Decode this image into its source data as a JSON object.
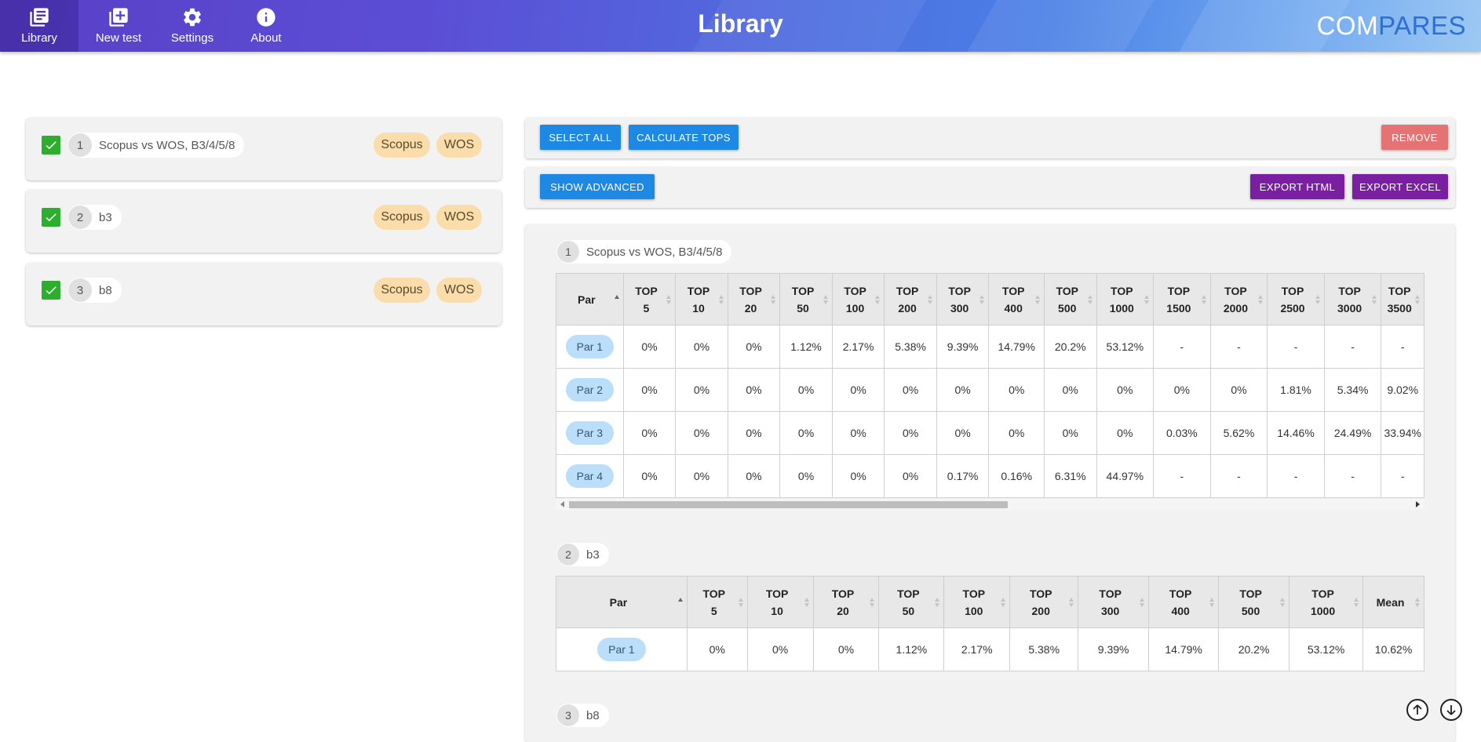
{
  "nav": [
    {
      "label": "Library",
      "icon": "library-icon"
    },
    {
      "label": "New test",
      "icon": "add-box-icon"
    },
    {
      "label": "Settings",
      "icon": "gear-icon"
    },
    {
      "label": "About",
      "icon": "info-icon"
    }
  ],
  "header": {
    "title": "Library",
    "brand_a": "COM",
    "brand_b": "PARES"
  },
  "colors": {
    "primary": "#1e88e5",
    "danger": "#e57373",
    "export": "#7b1fa2",
    "check": "#2eae2e",
    "db_chip": "#fbdcab",
    "par_chip": "#bbdefb"
  },
  "tests": [
    {
      "num": "1",
      "name": "Scopus vs WOS, B3/4/5/8",
      "db1": "Scopus",
      "db2": "WOS",
      "checked": true
    },
    {
      "num": "2",
      "name": "b3",
      "db1": "Scopus",
      "db2": "WOS",
      "checked": true
    },
    {
      "num": "3",
      "name": "b8",
      "db1": "Scopus",
      "db2": "WOS",
      "checked": true
    }
  ],
  "toolbar": {
    "select_all": "SELECT ALL",
    "calculate_tops": "CALCULATE TOPS",
    "remove": "REMOVE",
    "show_advanced": "SHOW ADVANCED",
    "export_html": "EXPORT HTML",
    "export_excel": "EXPORT EXCEL"
  },
  "results": [
    {
      "num": "1",
      "name": "Scopus vs WOS, B3/4/5/8",
      "headers": [
        [
          "Par",
          ""
        ],
        [
          "TOP",
          "5"
        ],
        [
          "TOP",
          "10"
        ],
        [
          "TOP",
          "20"
        ],
        [
          "TOP",
          "50"
        ],
        [
          "TOP",
          "100"
        ],
        [
          "TOP",
          "200"
        ],
        [
          "TOP",
          "300"
        ],
        [
          "TOP",
          "400"
        ],
        [
          "TOP",
          "500"
        ],
        [
          "TOP",
          "1000"
        ],
        [
          "TOP",
          "1500"
        ],
        [
          "TOP",
          "2000"
        ],
        [
          "TOP",
          "2500"
        ],
        [
          "TOP",
          "3000"
        ],
        [
          "TOP",
          "3500"
        ]
      ],
      "rows": [
        [
          "Par 1",
          "0%",
          "0%",
          "0%",
          "1.12%",
          "2.17%",
          "5.38%",
          "9.39%",
          "14.79%",
          "20.2%",
          "53.12%",
          "-",
          "-",
          "-",
          "-",
          "-"
        ],
        [
          "Par 2",
          "0%",
          "0%",
          "0%",
          "0%",
          "0%",
          "0%",
          "0%",
          "0%",
          "0%",
          "0%",
          "0%",
          "0%",
          "1.81%",
          "5.34%",
          "9.02%"
        ],
        [
          "Par 3",
          "0%",
          "0%",
          "0%",
          "0%",
          "0%",
          "0%",
          "0%",
          "0%",
          "0%",
          "0%",
          "0.03%",
          "5.62%",
          "14.46%",
          "24.49%",
          "33.94%"
        ],
        [
          "Par 4",
          "0%",
          "0%",
          "0%",
          "0%",
          "0%",
          "0%",
          "0.17%",
          "0.16%",
          "6.31%",
          "44.97%",
          "-",
          "-",
          "-",
          "-",
          "-"
        ]
      ]
    },
    {
      "num": "2",
      "name": "b3",
      "headers": [
        [
          "Par",
          ""
        ],
        [
          "TOP",
          "5"
        ],
        [
          "TOP",
          "10"
        ],
        [
          "TOP",
          "20"
        ],
        [
          "TOP",
          "50"
        ],
        [
          "TOP",
          "100"
        ],
        [
          "TOP",
          "200"
        ],
        [
          "TOP",
          "300"
        ],
        [
          "TOP",
          "400"
        ],
        [
          "TOP",
          "500"
        ],
        [
          "TOP",
          "1000"
        ],
        [
          "Mean",
          ""
        ]
      ],
      "rows": [
        [
          "Par 1",
          "0%",
          "0%",
          "0%",
          "1.12%",
          "2.17%",
          "5.38%",
          "9.39%",
          "14.79%",
          "20.2%",
          "53.12%",
          "10.62%"
        ]
      ]
    },
    {
      "num": "3",
      "name": "b8"
    }
  ]
}
